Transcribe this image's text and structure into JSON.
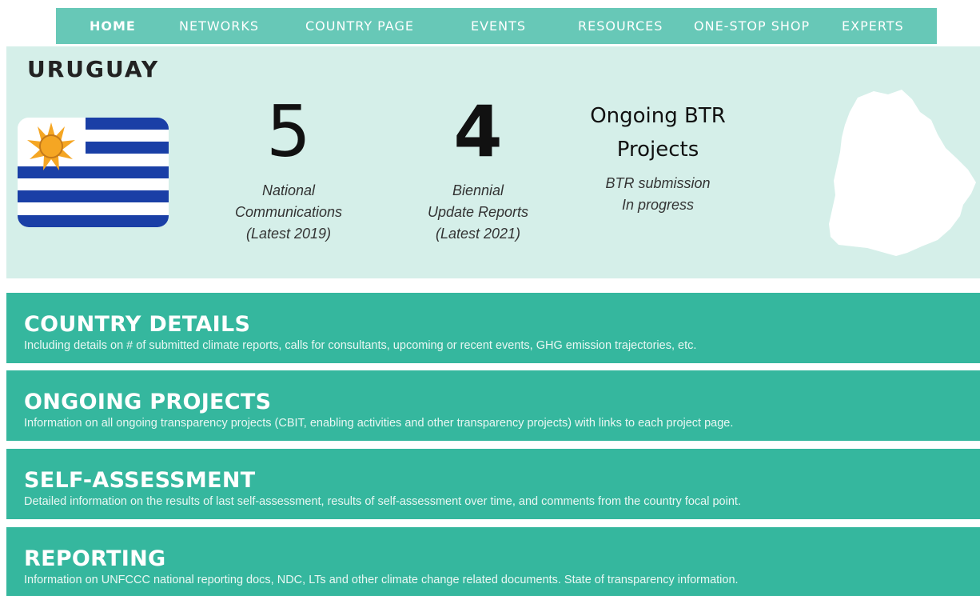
{
  "nav": {
    "items": [
      {
        "label": "HOME",
        "active": true
      },
      {
        "label": "NETWORKS",
        "active": false
      },
      {
        "label": "COUNTRY PAGE",
        "active": false
      },
      {
        "label": "EVENTS",
        "active": false
      },
      {
        "label": "RESOURCES",
        "active": false
      },
      {
        "label": "ONE-STOP SHOP",
        "active": false
      },
      {
        "label": "EXPERTS",
        "active": false
      }
    ]
  },
  "hero": {
    "country": "URUGUAY",
    "stats": [
      {
        "number": "5",
        "label": "National\nCommunications\n(Latest 2019)"
      },
      {
        "number": "4",
        "label": "Biennial\nUpdate Reports\n(Latest 2021)"
      }
    ],
    "btr": {
      "heading": "Ongoing BTR\nProjects",
      "label": "BTR submission\nIn progress"
    }
  },
  "sections": [
    {
      "title": "COUNTRY DETAILS",
      "desc": "Including details on # of submitted climate reports, calls for consultants, upcoming or recent events, GHG emission trajectories, etc."
    },
    {
      "title": "ONGOING PROJECTS",
      "desc": "Information on all ongoing transparency projects (CBIT, enabling activities and other transparency projects) with links to each project page."
    },
    {
      "title": "SELF-ASSESSMENT",
      "desc": "Detailed information on the results of last self-assessment, results of self-assessment over time, and comments from the country focal point."
    },
    {
      "title": "REPORTING",
      "desc": "Information on UNFCCC national reporting docs, NDC, LTs and other climate change related documents. State of transparency information."
    }
  ],
  "colors": {
    "nav_bg": "#67c8b7",
    "hero_bg": "#d5efe9",
    "section_bg": "#35b79e",
    "flag_blue": "#1a3fa6",
    "flag_sun": "#f5a623"
  }
}
